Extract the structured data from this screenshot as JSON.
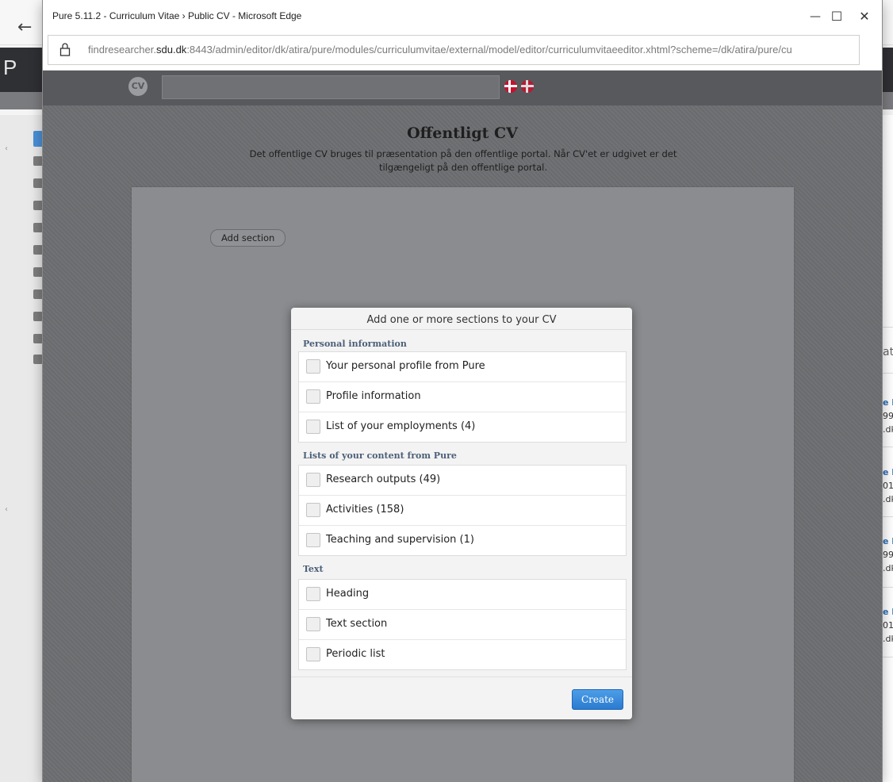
{
  "window": {
    "title": "Pure 5.11.2 - Curriculum Vitae › Public CV - Microsoft Edge",
    "minimize_glyph": "—",
    "maximize_glyph": "☐",
    "close_glyph": "✕"
  },
  "address_bar": {
    "url_prefix": "findresearcher.",
    "url_domain": "sdu.dk",
    "url_rest": ":8443/admin/editor/dk/atira/pure/modules/curriculumvitae/external/model/editor/curriculumvitaeeditor.xhtml?scheme=/dk/atira/pure/cu"
  },
  "background": {
    "back_glyph": "←",
    "brand": "P",
    "right_fragments": [
      "at",
      "e F",
      "99",
      ".dk",
      "e F",
      "01",
      ".dk",
      "e F",
      "99",
      ".dk",
      "e F",
      "01",
      ".dk"
    ]
  },
  "editor": {
    "logo": "CV",
    "page_title": "Offentligt CV",
    "description": "Det offentlige CV bruges til præsentation på den offentlige portal. Når CV'et er udgivet er det tilgængeligt på den offentlige portal.",
    "add_section_label": "Add section"
  },
  "dialog": {
    "title": "Add one or more sections to your CV",
    "groups": [
      {
        "label": "Personal information",
        "options": [
          "Your personal profile from Pure",
          "Profile information",
          "List of your employments (4)"
        ]
      },
      {
        "label": "Lists of your content from Pure",
        "options": [
          "Research outputs (49)",
          "Activities (158)",
          "Teaching and supervision (1)"
        ]
      },
      {
        "label": "Text",
        "options": [
          "Heading",
          "Text section",
          "Periodic list"
        ]
      }
    ],
    "create_label": "Create"
  },
  "colors": {
    "accent": "#2a7ad0",
    "group_label": "#4c5f78",
    "overlay": "#6c6e71"
  }
}
